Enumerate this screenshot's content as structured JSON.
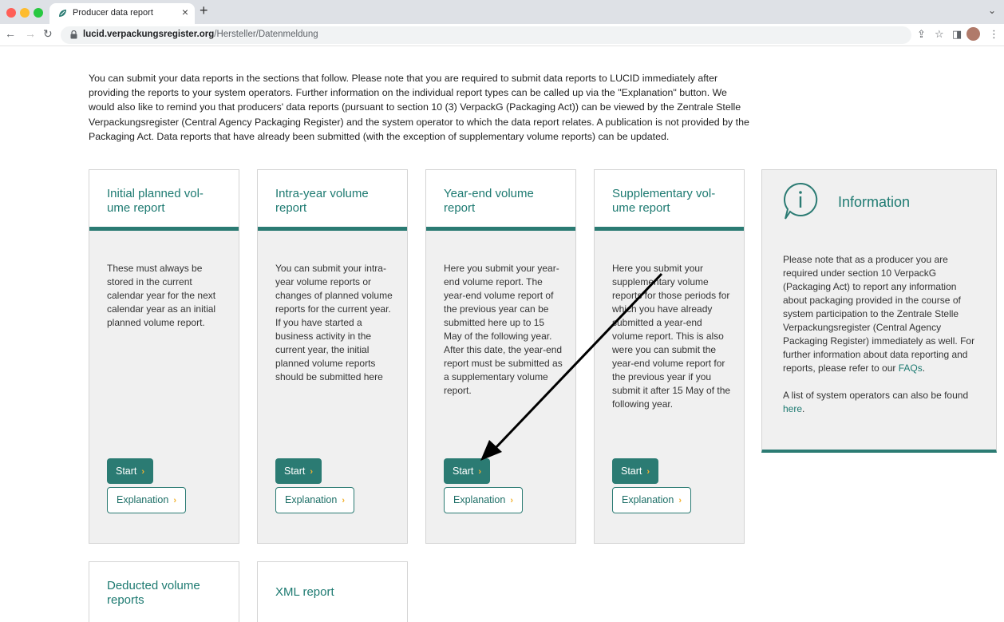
{
  "browser": {
    "tab_title": "Producer data report",
    "tab_close": "×",
    "new_tab": "+",
    "tab_menu": "⌄",
    "url_host": "lucid.verpackungsregister.org",
    "url_path": "/Hersteller/Datenmeldung",
    "icons": [
      "back-icon",
      "forward-icon",
      "reload-icon",
      "lock-icon",
      "share-icon",
      "star-icon",
      "sidepanel-icon",
      "profile-icon",
      "menu-icon"
    ]
  },
  "intro": "You can submit your data reports in the sections that follow. Please note that you are required to submit data reports to LUCID immediately after providing the reports to your system operators. Further information on the individual report types can be called up via the \"Explanation\" button. We would also like to remind you that producers' data reports (pursuant to section 10 (3) VerpackG (Packaging Act)) can be viewed by the Zentrale Stelle Verpackungsregister (Central Agency Packaging Register) and the system operator to which the data report relates. A publication is not provided by the Packaging Act. Data reports that have already been submitted (with the exception of supplementary volume reports) can be updated.",
  "cards": [
    {
      "title": "Initial planned vol-ume report",
      "body": "These must always be stored in the current calendar year for the next calendar year as an initial planned volume report.",
      "start": "Start",
      "explanation": "Explanation"
    },
    {
      "title": "Intra-year volume report",
      "body": "You can submit your intra-year volume reports or changes of planned volume reports for the current year. If you have started a business activity in the current year, the initial planned volume reports should be submitted here",
      "start": "Start",
      "explanation": "Explanation"
    },
    {
      "title": "Year-end volume report",
      "body": "Here you submit your year-end volume report. The year-end volume report of the previous year can be submitted here up to 15 May of the following year. After this date, the year-end report must be submitted as a supplementary volume report.",
      "start": "Start",
      "explanation": "Explanation"
    },
    {
      "title": "Supplementary vol-ume report",
      "body": "Here you submit your supplementary volume reports for those periods for which you have already submitted a year-end volume report. This is also were you can submit the year-end volume report for the previous year if you submit it after 15 May of the following year.",
      "start": "Start",
      "explanation": "Explanation"
    }
  ],
  "info": {
    "title": "Information",
    "para1_text": "Please note that as a producer you are required under section 10 VerpackG (Packaging Act) to report any information about packaging provided in the course of system participation to the Zentrale Stelle Verpackungsregister (Central Agency Packaging Register) immediately as well. For further information about data reporting and reports, please refer to our ",
    "para1_link": "FAQs",
    "para1_end": ".",
    "para2_text": "A list of system operators can also be found ",
    "para2_link": "here",
    "para2_end": "."
  },
  "bottom_cards": [
    {
      "title": "Deducted volume reports"
    },
    {
      "title": "XML report"
    }
  ],
  "colors": {
    "accent": "#2b7b73",
    "title_text": "#1d7a71",
    "chevron": "#f2b22f",
    "card_bg": "#f0f0f0"
  }
}
